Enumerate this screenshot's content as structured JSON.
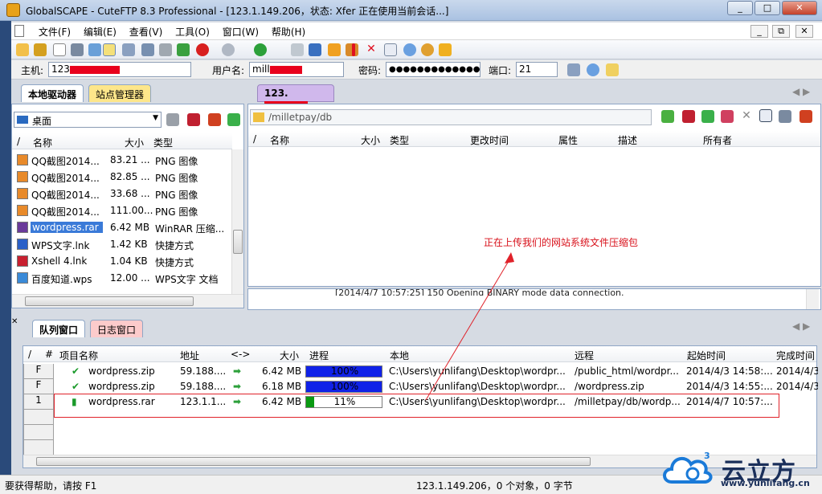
{
  "window": {
    "title": "GlobalSCAPE - CuteFTP 8.3 Professional - [123.1.149.206，状态: Xfer 正在使用当前会话...]",
    "buttons": [
      "_",
      "□",
      "✕"
    ]
  },
  "menu": {
    "items": [
      "文件(F)",
      "编辑(E)",
      "查看(V)",
      "工具(O)",
      "窗口(W)",
      "帮助(H)"
    ],
    "mdi_buttons": [
      "_",
      "⧉",
      "✕"
    ]
  },
  "address_bar": {
    "host_label": "主机:",
    "host_value": "123",
    "user_label": "用户名:",
    "user_value": "mill",
    "password_label": "密码:",
    "password_value": "●●●●●●●●●●●●●●",
    "port_label": "端口:",
    "port_value": "21"
  },
  "left_panel": {
    "tabs": [
      "本地驱动器",
      "站点管理器"
    ],
    "location": "桌面",
    "headers": [
      "/",
      "名称",
      "大小",
      "类型"
    ],
    "files": [
      {
        "name": "QQ截图2014...",
        "size": "83.21 ...",
        "type": "PNG 图像"
      },
      {
        "name": "QQ截图2014...",
        "size": "82.85 ...",
        "type": "PNG 图像"
      },
      {
        "name": "QQ截图2014...",
        "size": "33.68 ...",
        "type": "PNG 图像"
      },
      {
        "name": "QQ截图2014...",
        "size": "111.00...",
        "type": "PNG 图像"
      },
      {
        "name": "wordpress.rar",
        "size": "6.42 MB",
        "type": "WinRAR 压缩..."
      },
      {
        "name": "WPS文字.lnk",
        "size": "1.42 KB",
        "type": "快捷方式"
      },
      {
        "name": "Xshell 4.lnk",
        "size": "1.04 KB",
        "type": "快捷方式"
      },
      {
        "name": "百度知道.wps",
        "size": "12.00 ...",
        "type": "WPS文字 文档"
      }
    ]
  },
  "right_panel": {
    "tab": "123.",
    "path": "/milletpay/db",
    "headers": [
      "/",
      "名称",
      "大小",
      "类型",
      "更改时间",
      "属性",
      "描述",
      "所有者"
    ],
    "log_line": "[2014/4/7 10:57:25] 150 Opening BINARY mode data connection."
  },
  "annotation": {
    "text": "正在上传我们的网站系统文件压缩包"
  },
  "queue": {
    "tabs": [
      "队列窗口",
      "日志窗口"
    ],
    "headers": [
      "/",
      "#",
      "项目名称",
      "地址",
      "<->",
      "大小",
      "进程",
      "本地",
      "远程",
      "起始时间",
      "完成时间"
    ],
    "rows": [
      {
        "idx": "F",
        "name": "wordpress.zip",
        "addr": "59.188....",
        "size": "6.42 MB",
        "progress_pct": 100,
        "progress_label": "100%",
        "local": "C:\\Users\\yunlifang\\Desktop\\wordpr...",
        "remote": "/public_html/wordpr...",
        "start": "2014/4/3 14:58:...",
        "end": "2014/4/3"
      },
      {
        "idx": "F",
        "name": "wordpress.zip",
        "addr": "59.188....",
        "size": "6.18 MB",
        "progress_pct": 100,
        "progress_label": "100%",
        "local": "C:\\Users\\yunlifang\\Desktop\\wordpr...",
        "remote": "/wordpress.zip",
        "start": "2014/4/3 14:55:...",
        "end": "2014/4/3"
      },
      {
        "idx": "1",
        "name": "wordpress.rar",
        "addr": "123.1.1...",
        "size": "6.42 MB",
        "progress_pct": 11,
        "progress_label": "11%",
        "local": "C:\\Users\\yunlifang\\Desktop\\wordpr...",
        "remote": "/milletpay/db/wordp...",
        "start": "2014/4/7 10:57:...",
        "end": ""
      }
    ]
  },
  "status_bar": {
    "help": "要获得帮助，请按 F1",
    "info": "123.1.149.206，0 个对象，0 字节"
  },
  "watermark": {
    "text": "云立方",
    "url": "www.yunlifang.cn"
  },
  "colors": {
    "annotation_red": "#e0222a",
    "progress_blue": "#1022e8",
    "progress_green": "#0a9a12"
  }
}
